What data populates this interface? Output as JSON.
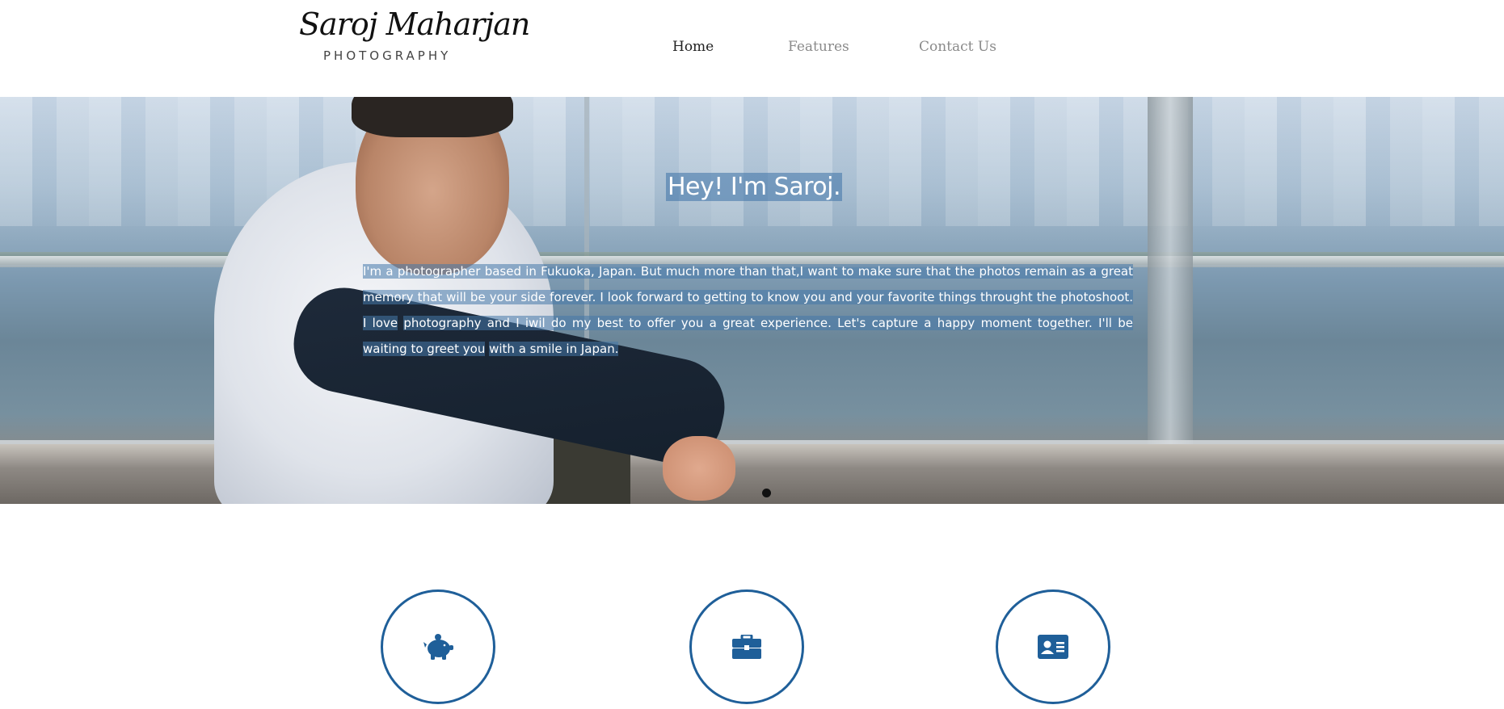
{
  "header": {
    "logo_script": "Saroj Maharjan",
    "logo_sub": "PHOTOGRAPHY"
  },
  "nav": {
    "items": [
      {
        "label": "Home",
        "active": true
      },
      {
        "label": "Features",
        "active": false
      },
      {
        "label": "Contact Us",
        "active": false
      }
    ]
  },
  "hero": {
    "title": "Hey! I'm Saroj.",
    "line1": "I'm a photographer based in Fukuoka, Japan. But much more than that,I want to make sure that the photos remain as a great",
    "line2": "memory that will be your side forever. I look forward to getting to know you and your favorite things throught the photoshoot. I love",
    "line3": "photography and I iwil do my best to offer you a great experience. Let's capture a happy moment together. I'll be waiting to greet you",
    "line4": "with a smile in Japan."
  },
  "features": [
    {
      "icon": "piggy-bank-icon"
    },
    {
      "icon": "briefcase-icon"
    },
    {
      "icon": "id-card-icon"
    }
  ],
  "colors": {
    "accent": "#1f5f99",
    "text_highlight": "#4678aa"
  }
}
